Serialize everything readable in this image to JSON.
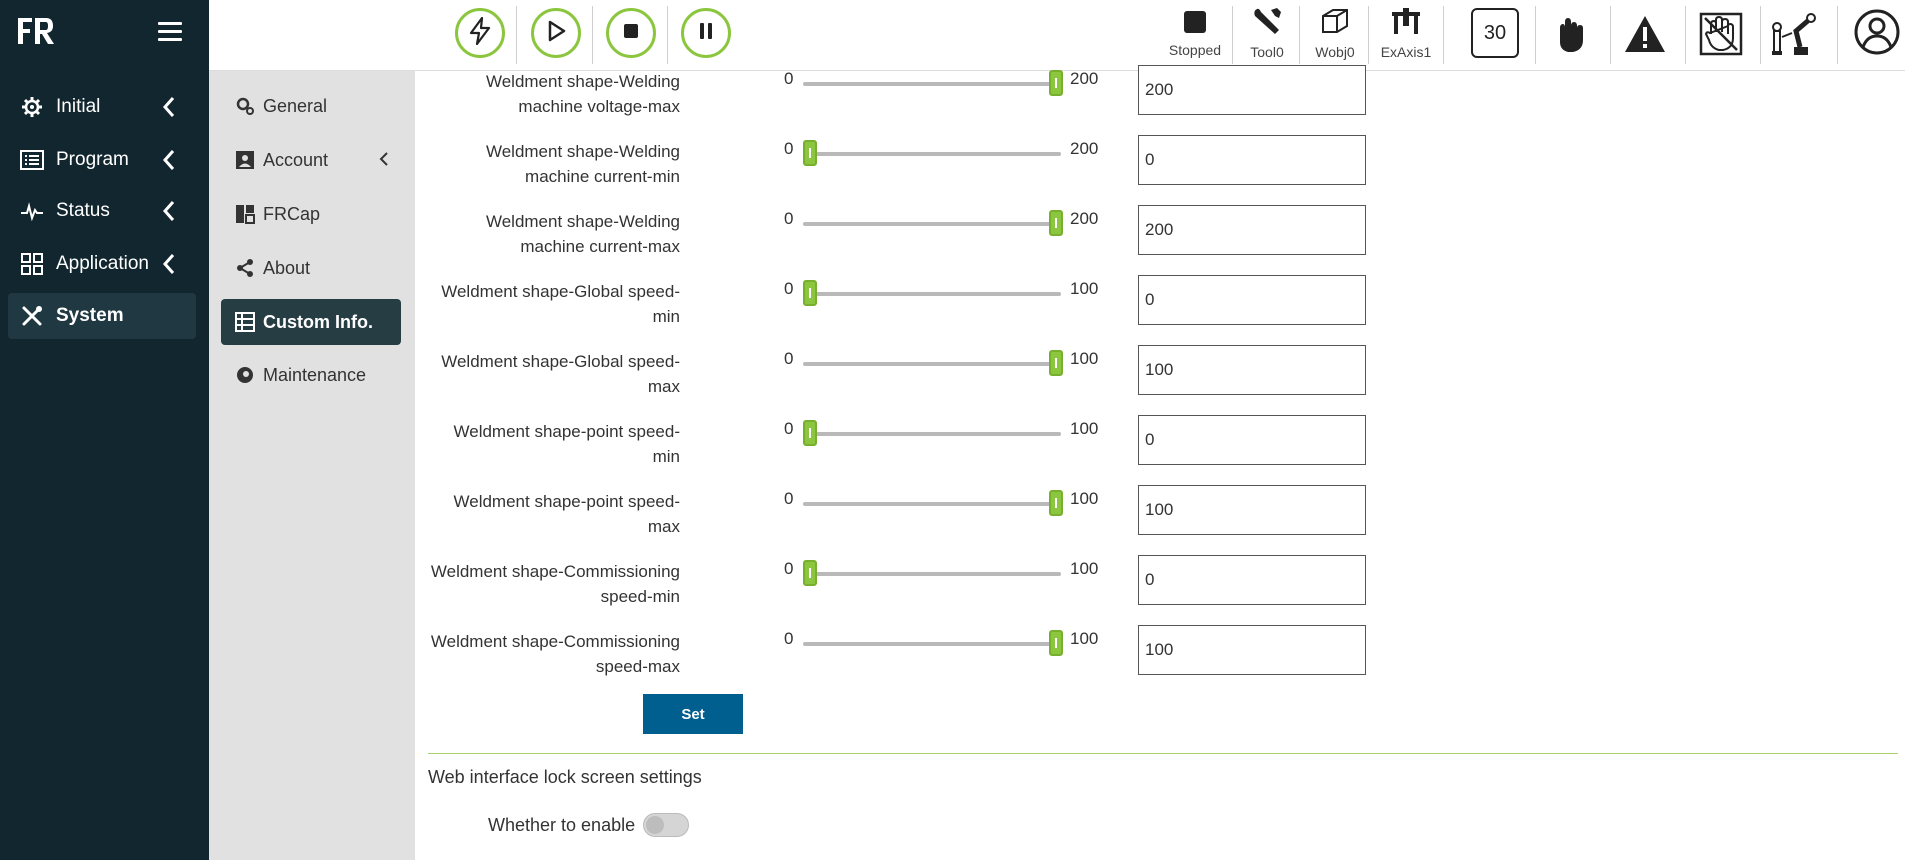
{
  "app": {
    "logo_text": "FR"
  },
  "sidebar": {
    "items": [
      {
        "label": "Initial",
        "icon": "gear-icon"
      },
      {
        "label": "Program",
        "icon": "list-icon"
      },
      {
        "label": "Status",
        "icon": "pulse-icon"
      },
      {
        "label": "Application",
        "icon": "grid-icon"
      },
      {
        "label": "System",
        "icon": "tools-icon",
        "active": true
      }
    ]
  },
  "subnav": {
    "items": [
      {
        "label": "General",
        "icon": "gears-icon"
      },
      {
        "label": "Account",
        "icon": "id-card-icon"
      },
      {
        "label": "FRCap",
        "icon": "plugin-icon"
      },
      {
        "label": "About",
        "icon": "share-icon"
      },
      {
        "label": "Custom Info.",
        "icon": "table-icon",
        "active": true
      },
      {
        "label": "Maintenance",
        "icon": "maintenance-icon"
      }
    ]
  },
  "toolbar": {
    "status_label": "Stopped",
    "tool_label": "Tool0",
    "wobj_label": "Wobj0",
    "exaxis_label": "ExAxis1",
    "speed_value": "30"
  },
  "params": [
    {
      "label_line1": "Weldment shape-Welding",
      "label_line2": "machine voltage-max",
      "min": "0",
      "max": "200",
      "value": "200",
      "fraction": 1
    },
    {
      "label_line1": "Weldment shape-Welding",
      "label_line2": "machine current-min",
      "min": "0",
      "max": "200",
      "value": "0",
      "fraction": 0
    },
    {
      "label_line1": "Weldment shape-Welding",
      "label_line2": "machine current-max",
      "min": "0",
      "max": "200",
      "value": "200",
      "fraction": 1
    },
    {
      "label_line1": "Weldment shape-Global speed-",
      "label_line2": "min",
      "min": "0",
      "max": "100",
      "value": "0",
      "fraction": 0
    },
    {
      "label_line1": "Weldment shape-Global speed-",
      "label_line2": "max",
      "min": "0",
      "max": "100",
      "value": "100",
      "fraction": 1
    },
    {
      "label_line1": "Weldment shape-point speed-",
      "label_line2": "min",
      "min": "0",
      "max": "100",
      "value": "0",
      "fraction": 0
    },
    {
      "label_line1": "Weldment shape-point speed-",
      "label_line2": "max",
      "min": "0",
      "max": "100",
      "value": "100",
      "fraction": 1
    },
    {
      "label_line1": "Weldment shape-Commissioning",
      "label_line2": "speed-min",
      "min": "0",
      "max": "100",
      "value": "0",
      "fraction": 0
    },
    {
      "label_line1": "Weldment shape-Commissioning",
      "label_line2": "speed-max",
      "min": "0",
      "max": "100",
      "value": "100",
      "fraction": 1
    }
  ],
  "set_button_label": "Set",
  "lock_section": {
    "title": "Web interface lock screen settings",
    "enable_label": "Whether to enable",
    "enabled": false
  },
  "colors": {
    "accent": "#8cc63f",
    "sidebar_bg": "#12262f",
    "button_blue": "#005f8f"
  }
}
